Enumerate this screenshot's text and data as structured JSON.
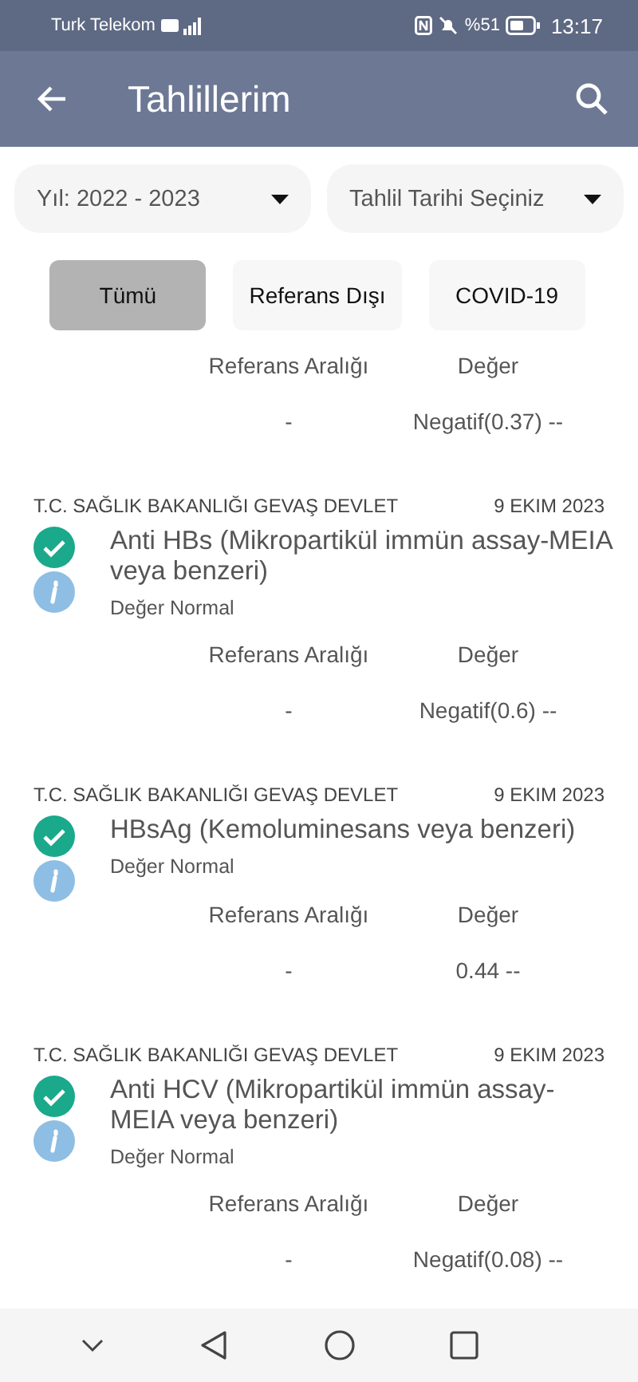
{
  "status_bar": {
    "carrier": "Turk Telekom",
    "battery": "%51",
    "time": "13:17"
  },
  "app_bar": {
    "title": "Tahlillerim"
  },
  "filters": [
    {
      "label": "Yıl: 2022 - 2023"
    },
    {
      "label": "Tahlil Tarihi Seçiniz"
    }
  ],
  "chips": [
    {
      "label": "Tümü",
      "selected": true
    },
    {
      "label": "Referans Dışı",
      "selected": false
    },
    {
      "label": "COVID-19",
      "selected": false
    }
  ],
  "results": [
    {
      "kind": "partial",
      "ref_header": "Referans Aralığı",
      "value_header": "Değer",
      "ref": "-",
      "value": "Negatif(0.37) --"
    },
    {
      "kind": "full",
      "source": "T.C. SAĞLIK BAKANLIĞI GEVAŞ DEVLET",
      "date": "9 EKIM 2023",
      "normal": true,
      "title": "Anti HBs (Mikropartikül immün assay-MEIA veya benzeri)",
      "status": "Değer Normal",
      "ref_header": "Referans Aralığı",
      "value_header": "Değer",
      "ref": "-",
      "value": "Negatif(0.6) --"
    },
    {
      "kind": "full",
      "source": "T.C. SAĞLIK BAKANLIĞI GEVAŞ DEVLET",
      "date": "9 EKIM 2023",
      "normal": true,
      "title": "HBsAg (Kemoluminesans veya benzeri)",
      "status": "Değer Normal",
      "ref_header": "Referans Aralığı",
      "value_header": "Değer",
      "ref": "-",
      "value": "0.44 --"
    },
    {
      "kind": "full",
      "source": "T.C. SAĞLIK BAKANLIĞI GEVAŞ DEVLET",
      "date": "9 EKIM 2023",
      "normal": true,
      "title": "Anti HCV (Mikropartikül immün assay-MEIA veya benzeri)",
      "status": "Değer Normal",
      "ref_header": "Referans Aralığı",
      "value_header": "Değer",
      "ref": "-",
      "value": "Negatif(0.08) --"
    }
  ]
}
